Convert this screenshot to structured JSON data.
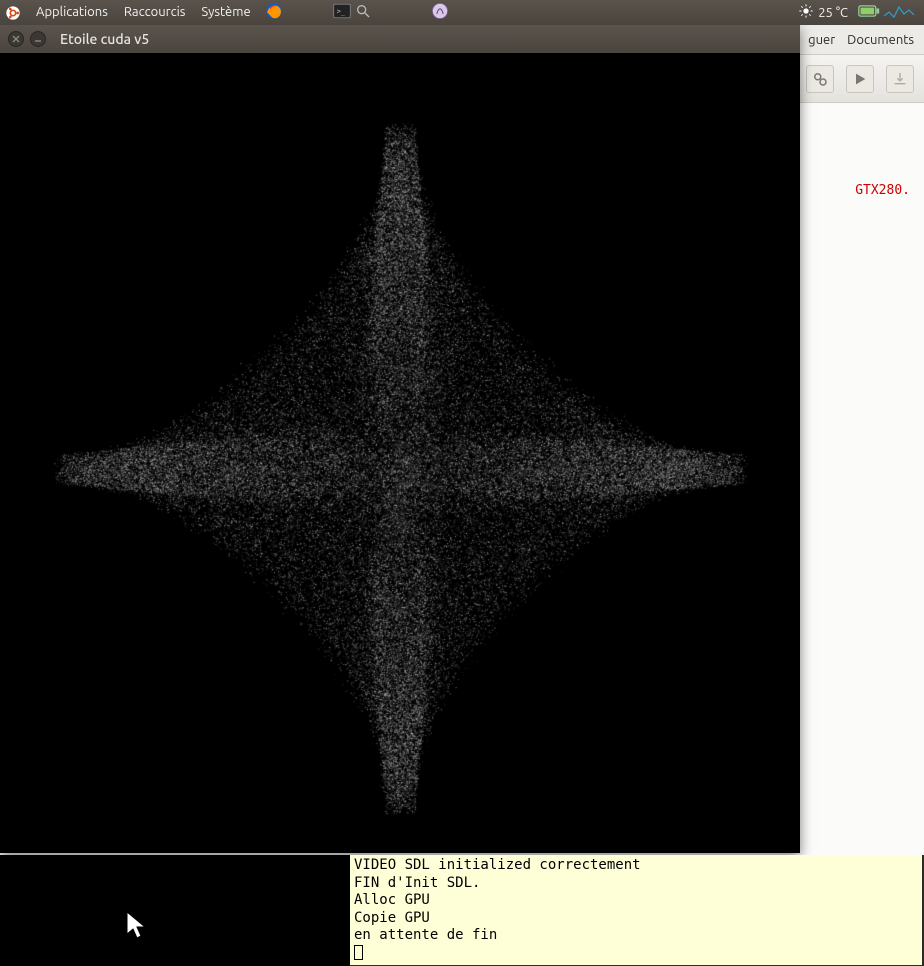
{
  "panel": {
    "menus": [
      "Applications",
      "Raccourcis",
      "Système"
    ],
    "temperature": "25 °C"
  },
  "window": {
    "title": "Etoile cuda v5"
  },
  "ide": {
    "menu_items": [
      "guer",
      "Documents"
    ],
    "error": "GTX280."
  },
  "terminal": {
    "lines": [
      "VIDEO SDL initialized correctement",
      "FIN d'Init SDL.",
      "Alloc GPU",
      "Copie GPU",
      "en attente de fin"
    ]
  }
}
